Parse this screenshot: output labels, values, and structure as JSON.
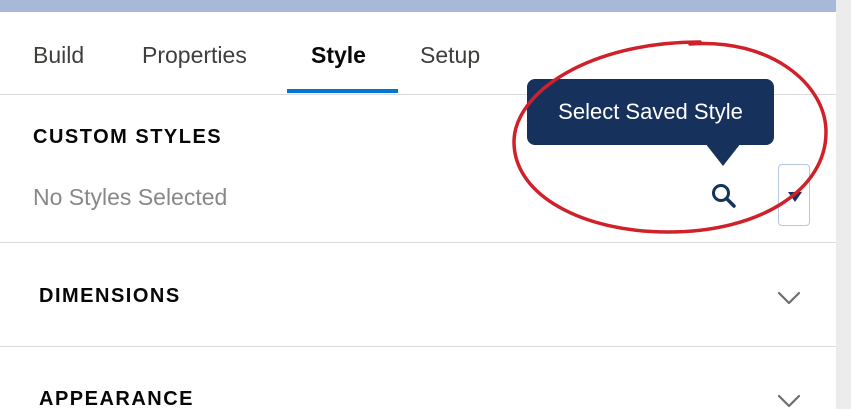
{
  "tabs": [
    {
      "label": "Build"
    },
    {
      "label": "Properties"
    },
    {
      "label": "Style"
    },
    {
      "label": "Setup"
    }
  ],
  "active_tab": "Style",
  "custom_styles": {
    "heading": "CUSTOM STYLES",
    "value": "No Styles Selected",
    "search_icon": "search-icon",
    "dropdown_icon": "caret-down-icon"
  },
  "tooltip": {
    "text": "Select Saved Style"
  },
  "sections": [
    {
      "label": "DIMENSIONS",
      "icon": "chevron-down-icon"
    },
    {
      "label": "APPEARANCE",
      "icon": "chevron-down-icon"
    }
  ],
  "colors": {
    "accent": "#0176d3",
    "tooltip_bg": "#16325c",
    "annotation": "#d0202a"
  }
}
